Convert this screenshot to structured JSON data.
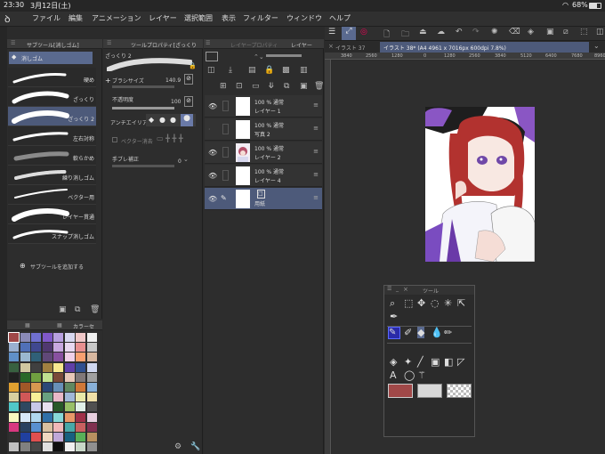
{
  "status": {
    "time": "23:30",
    "date": "3月12日(土)",
    "battery": "68%"
  },
  "menu": [
    "ファイル",
    "編集",
    "アニメーション",
    "レイヤー",
    "選択範囲",
    "表示",
    "フィルター",
    "ウィンドウ",
    "ヘルプ"
  ],
  "subtool": {
    "title": "サブツール[消しゴム]",
    "group": "消しゴム",
    "add_label": "サブツールを追加する",
    "brushes": [
      "硬め",
      "ざっくり",
      "ざっくり 2",
      "左右対称",
      "軟らかめ",
      "練り消しゴム",
      "ベクター用",
      "レイヤー貫通",
      "スナップ消しゴム"
    ]
  },
  "toolprop": {
    "title": "ツールプロパティ[ざっくり",
    "preview": "ざっくり 2",
    "brush_size_label": "ブラシサイズ",
    "brush_size": "140.9",
    "opacity_label": "不透明度",
    "opacity": "100",
    "antialias_label": "アンチエイリア",
    "vector_label": "ベクター消去",
    "stabilize_label": "手ブレ補正",
    "stabilize": "0"
  },
  "layers": {
    "tab1": "レイヤープロパティ",
    "tab2": "レイヤー",
    "items": [
      {
        "mode": "100 % 通常",
        "name": "レイヤー 1"
      },
      {
        "mode": "100 % 通常",
        "name": "写真 2"
      },
      {
        "mode": "100 % 通常",
        "name": "レイヤー 2"
      },
      {
        "mode": "100 % 通常",
        "name": "レイヤー 4"
      },
      {
        "mode": "",
        "name": "用紙"
      }
    ]
  },
  "canvas": {
    "tab1": "イラスト 37",
    "tab2": "イラスト 38* (A4 4961 x 7016px 600dpi 7.8%)",
    "ruler": [
      "3840",
      "2560",
      "1280",
      "0",
      "1280",
      "2560",
      "3840",
      "5120",
      "6400",
      "7680",
      "8960"
    ]
  },
  "colorset": {
    "title": "カラーセ"
  },
  "toolpalette": {
    "title": "ツール"
  },
  "colors": {
    "accent": "#3d5a99",
    "main_color": "#a04848",
    "sub_color": "#d8d8d8"
  }
}
